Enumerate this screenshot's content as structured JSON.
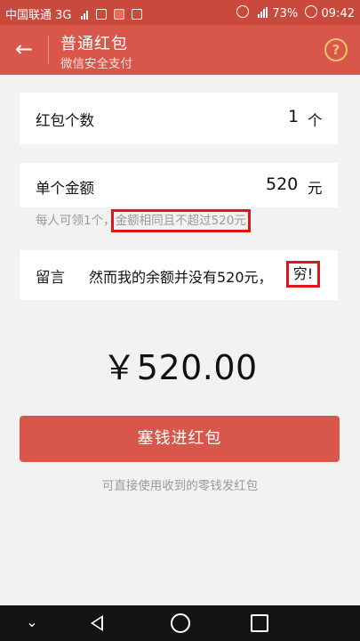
{
  "status_bar": {
    "carrier": "中国联通 3G",
    "battery": "73%",
    "time": "09:42"
  },
  "header": {
    "title": "普通红包",
    "subtitle": "微信安全支付",
    "help_symbol": "?"
  },
  "form": {
    "count_label": "红包个数",
    "count_value": "1",
    "count_unit": "个",
    "amount_label": "单个金额",
    "amount_value": "520",
    "amount_unit": "元",
    "hint_prefix": "每人可领1个，",
    "hint_highlight": "金额相同且不超过520元",
    "message_label": "留言",
    "message_text": "然而我的余额并没有520元，",
    "message_end": "穷!"
  },
  "total": "￥520.00",
  "submit_button": "塞钱进红包",
  "footnote": "可直接使用收到的零钱发红包",
  "colors": {
    "header": "#d9574a",
    "status_bar": "#c9493d",
    "button": "#d9574a",
    "highlight_box": "#e0141b"
  },
  "icons": {
    "back": "arrow-left-icon",
    "help": "question-circle-icon",
    "nav_back": "triangle-back-icon",
    "nav_home": "circle-home-icon",
    "nav_recent": "square-recent-icon"
  }
}
